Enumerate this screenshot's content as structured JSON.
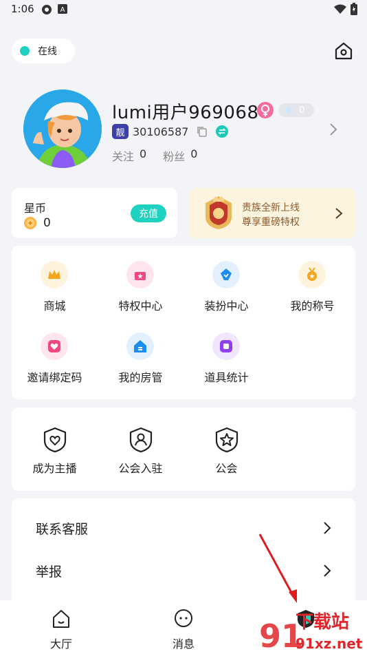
{
  "status_bar": {
    "time": "1:06"
  },
  "header": {
    "online_label": "在线",
    "home_icon": "home-icon"
  },
  "profile": {
    "username": "lumi用户969068",
    "diamond_count": "0",
    "id_tag": "靓",
    "user_id": "30106587",
    "follow_label": "关注",
    "follow_count": "0",
    "fans_label": "粉丝",
    "fans_count": "0"
  },
  "coin_card": {
    "title": "星币",
    "value": "0",
    "recharge_label": "充值"
  },
  "noble_card": {
    "line1": "贵族全新上线",
    "line2": "尊享重磅特权"
  },
  "menu": {
    "items": [
      {
        "label": "商城",
        "icon": "crown-icon",
        "color": "#f7a41d"
      },
      {
        "label": "特权中心",
        "icon": "gift-icon",
        "color": "#f0477e"
      },
      {
        "label": "装扮中心",
        "icon": "shirt-icon",
        "color": "#1b8ef0"
      },
      {
        "label": "我的称号",
        "icon": "medal-icon",
        "color": "#f7a41d"
      },
      {
        "label": "邀请绑定码",
        "icon": "heart-icon",
        "color": "#f0477e"
      },
      {
        "label": "我的房管",
        "icon": "house-icon",
        "color": "#1b8ef0"
      },
      {
        "label": "道具统计",
        "icon": "box-icon",
        "color": "#8f3ef0"
      }
    ]
  },
  "streamer": {
    "items": [
      {
        "label": "成为主播",
        "icon": "heart-shield-icon"
      },
      {
        "label": "公会入驻",
        "icon": "person-shield-icon"
      },
      {
        "label": "公会",
        "icon": "star-shield-icon"
      }
    ]
  },
  "list": {
    "items": [
      {
        "label": "联系客服"
      },
      {
        "label": "举报"
      }
    ]
  },
  "bottom_nav": {
    "items": [
      {
        "label": "大厅",
        "icon": "home-smile-icon"
      },
      {
        "label": "消息",
        "icon": "chat-bubble-icon"
      }
    ]
  },
  "watermark": {
    "text_top": "下载站",
    "text_bottom": "91xz.net",
    "logo": "91"
  }
}
